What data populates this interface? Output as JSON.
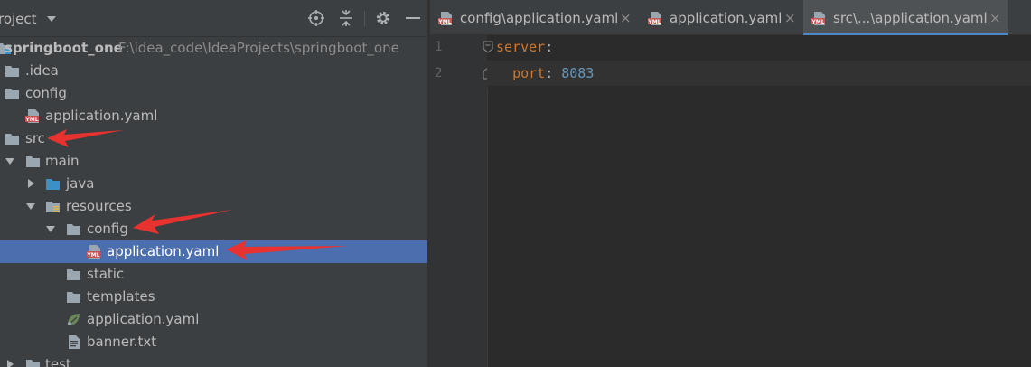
{
  "project_panel": {
    "title": "roject",
    "header_icons": [
      "locate-icon",
      "collapse-icon",
      "gear-icon",
      "minimize-icon"
    ],
    "tree": [
      {
        "id": "root",
        "label": "springboot_one",
        "path": "F:\\idea_code\\IdeaProjects\\springboot_one",
        "icon": "module-folder-icon",
        "expanded": true,
        "bold": true
      },
      {
        "id": "idea",
        "label": ".idea",
        "icon": "folder-icon"
      },
      {
        "id": "config",
        "label": "config",
        "icon": "folder-icon",
        "expanded": true
      },
      {
        "id": "config_app",
        "label": "application.yaml",
        "icon": "yml-file-icon"
      },
      {
        "id": "src",
        "label": "src",
        "icon": "folder-icon",
        "expanded": true
      },
      {
        "id": "main",
        "label": "main",
        "icon": "folder-icon",
        "expanded": true
      },
      {
        "id": "java",
        "label": "java",
        "icon": "source-folder-icon",
        "expanded": false
      },
      {
        "id": "resources",
        "label": "resources",
        "icon": "resources-folder-icon",
        "expanded": true
      },
      {
        "id": "res_config",
        "label": "config",
        "icon": "folder-icon",
        "expanded": true
      },
      {
        "id": "res_config_app",
        "label": "application.yaml",
        "icon": "yml-file-icon",
        "selected": true
      },
      {
        "id": "static",
        "label": "static",
        "icon": "folder-icon"
      },
      {
        "id": "templates",
        "label": "templates",
        "icon": "folder-icon"
      },
      {
        "id": "res_app",
        "label": "application.yaml",
        "icon": "spring-config-icon"
      },
      {
        "id": "banner",
        "label": "banner.txt",
        "icon": "text-file-icon"
      },
      {
        "id": "test",
        "label": "test",
        "icon": "folder-icon",
        "expanded": false
      }
    ]
  },
  "editor": {
    "tabs": [
      {
        "label": "config\\application.yaml",
        "icon": "yml-file-icon",
        "active": false
      },
      {
        "label": "application.yaml",
        "icon": "yml-file-icon",
        "active": false
      },
      {
        "label": "src\\...\\application.yaml",
        "icon": "yml-file-icon",
        "active": true
      }
    ],
    "close_glyph": "×",
    "line_numbers": [
      "1",
      "2"
    ],
    "code": {
      "line1_key": "server",
      "line1_colon": ":",
      "line2_key": "port",
      "line2_colon": ":",
      "line2_value": "8083"
    }
  },
  "annotation": {
    "arrow_color": "#e8322f",
    "arrows_point_to": [
      "src",
      "config",
      "application.yaml"
    ]
  },
  "colors": {
    "panel_bg": "#3c3f41",
    "editor_bg": "#2b2b2b",
    "selection": "#4b6eaf",
    "folder": "#9aa7b0",
    "source_folder": "#3a91c7",
    "yaml_key": "#cc7832",
    "yaml_number": "#6897bb"
  }
}
